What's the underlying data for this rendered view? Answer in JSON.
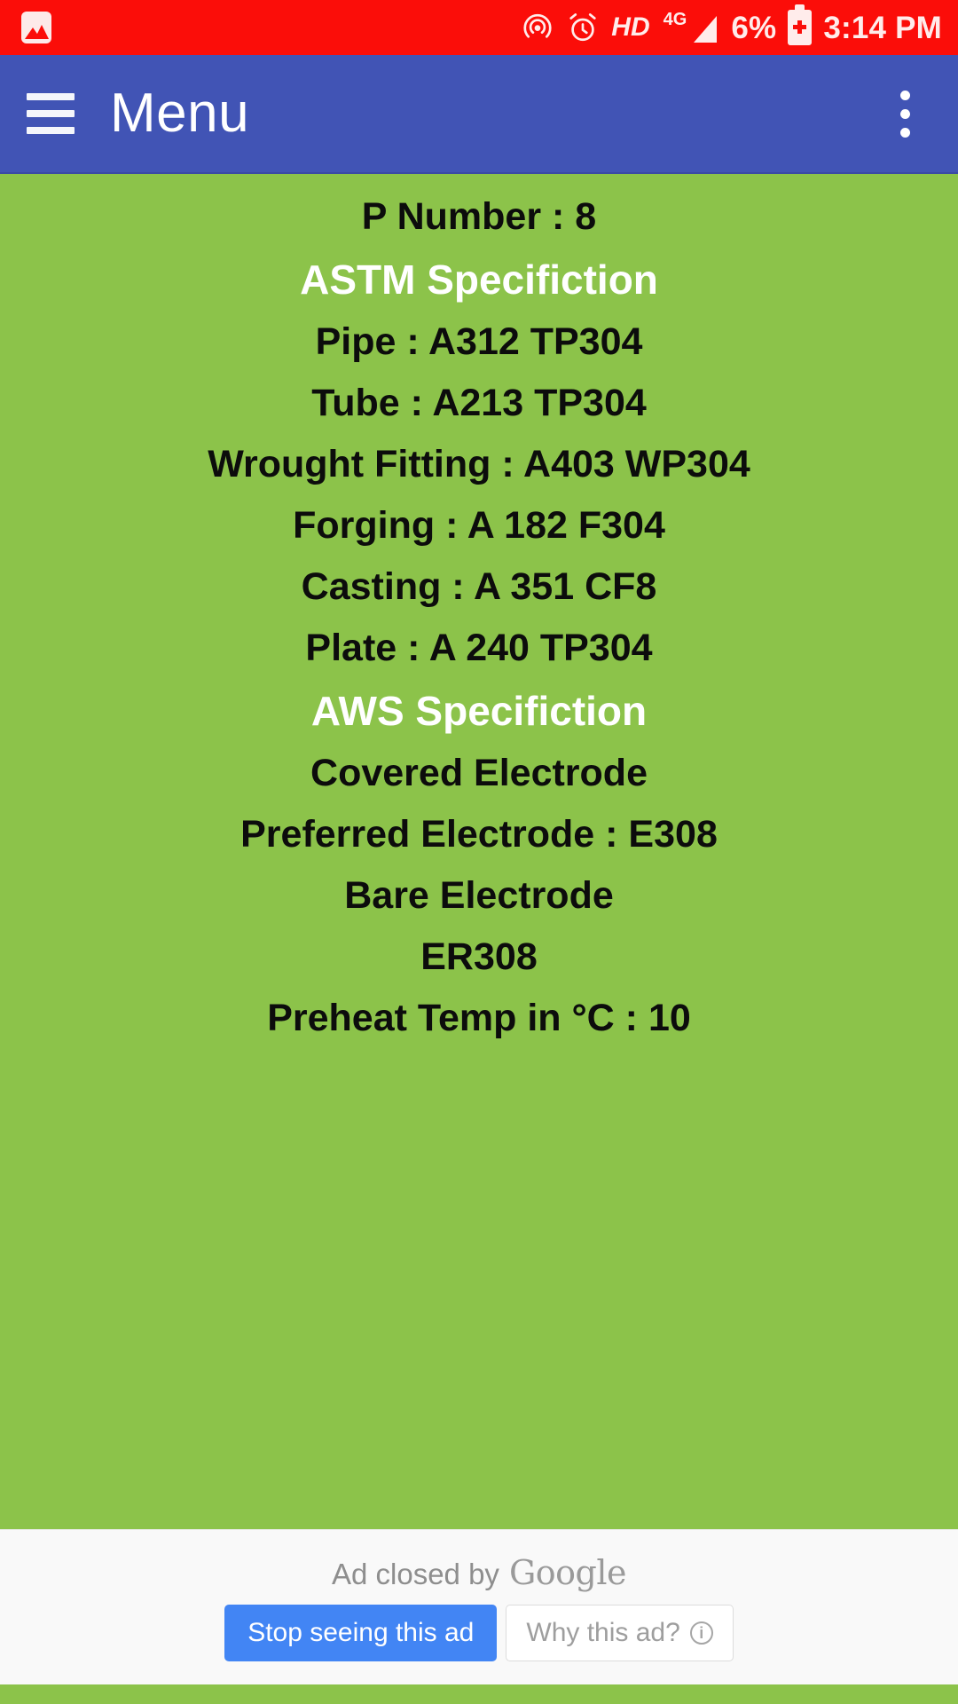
{
  "status_bar": {
    "background": "#FB0D09",
    "notification_icon": "image-icon",
    "hotspot_icon": "hotspot-icon",
    "alarm_icon": "alarm-icon",
    "hd_label": "HD",
    "network_label": "4G",
    "signal_icon": "signal-bars-icon",
    "battery_percent": "6%",
    "battery_icon": "battery-charging-icon",
    "time": "3:14 PM"
  },
  "app_bar": {
    "background": "#4154B5",
    "menu_icon": "hamburger-menu-icon",
    "title": "Menu",
    "overflow_icon": "more-vertical-icon"
  },
  "content": {
    "background": "#8CC34A",
    "text_color": "#0C0C0C",
    "heading_color": "#FFFFFF",
    "rows": [
      {
        "text": "P Number : 8",
        "heading": false
      },
      {
        "text": "ASTM Specifiction",
        "heading": true
      },
      {
        "text": "Pipe : A312 TP304",
        "heading": false
      },
      {
        "text": "Tube : A213 TP304",
        "heading": false
      },
      {
        "text": "Wrought Fitting : A403 WP304",
        "heading": false
      },
      {
        "text": "Forging : A 182 F304",
        "heading": false
      },
      {
        "text": "Casting : A 351 CF8",
        "heading": false
      },
      {
        "text": "Plate : A 240 TP304",
        "heading": false
      },
      {
        "text": "AWS Specifiction",
        "heading": true
      },
      {
        "text": "Covered Electrode",
        "heading": false
      },
      {
        "text": "Preferred Electrode : E308",
        "heading": false
      },
      {
        "text": "Bare Electrode",
        "heading": false
      },
      {
        "text": "ER308",
        "heading": false
      },
      {
        "text": "Preheat Temp in °C : 10",
        "heading": false
      }
    ]
  },
  "ad_panel": {
    "background": "#F9F9F9",
    "closed_prefix": "Ad closed by",
    "brand": "Google",
    "stop_button": "Stop seeing this ad",
    "stop_button_color": "#4285F4",
    "why_button": "Why this ad?",
    "why_info_icon": "info-icon"
  }
}
